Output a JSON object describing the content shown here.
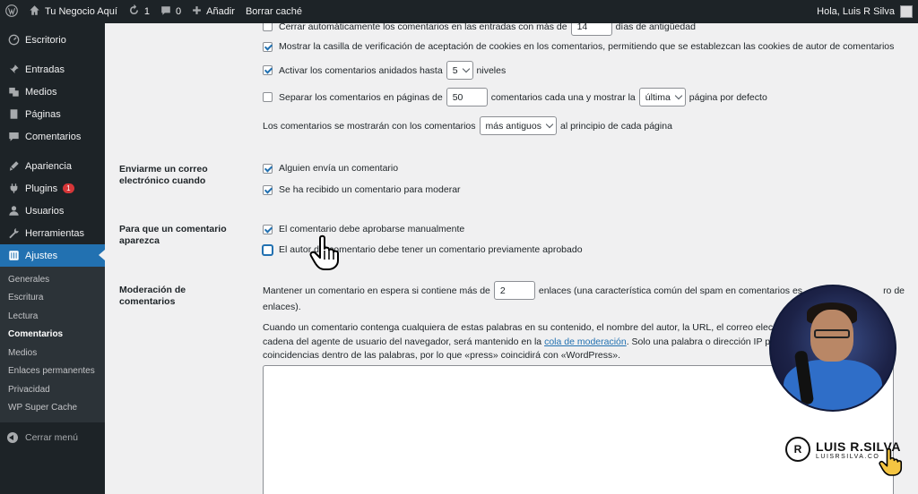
{
  "adminbar": {
    "site_name": "Tu Negocio Aquí",
    "updates_count": "1",
    "comments_count": "0",
    "add_new_label": "Añadir",
    "clear_cache_label": "Borrar caché",
    "greeting": "Hola, Luis R Silva"
  },
  "sidebar": {
    "items": [
      {
        "label": "Escritorio",
        "icon": "dashboard-icon"
      },
      {
        "label": "Entradas",
        "icon": "pin-icon"
      },
      {
        "label": "Medios",
        "icon": "media-icon"
      },
      {
        "label": "Páginas",
        "icon": "pages-icon"
      },
      {
        "label": "Comentarios",
        "icon": "comment-icon"
      },
      {
        "label": "Apariencia",
        "icon": "appearance-icon"
      },
      {
        "label": "Plugins",
        "icon": "plugins-icon",
        "badge": "1"
      },
      {
        "label": "Usuarios",
        "icon": "users-icon"
      },
      {
        "label": "Herramientas",
        "icon": "tools-icon"
      },
      {
        "label": "Ajustes",
        "icon": "settings-icon",
        "active": true
      }
    ],
    "submenu": [
      "Generales",
      "Escritura",
      "Lectura",
      "Comentarios",
      "Medios",
      "Enlaces permanentes",
      "Privacidad",
      "WP Super Cache"
    ],
    "submenu_current": "Comentarios",
    "collapse_label": "Cerrar menú"
  },
  "settings": {
    "close_comments": {
      "pre": "Cerrar automáticamente los comentarios en las entradas con más de",
      "value": "14",
      "post": "días de antigüedad",
      "checked": false
    },
    "cookies_opt_in": {
      "label": "Mostrar la casilla de verificación de aceptación de cookies en los comentarios, permitiendo que se establezcan las cookies de autor de comentarios",
      "checked": true
    },
    "threaded": {
      "pre": "Activar los comentarios anidados hasta",
      "value": "5",
      "post": "niveles",
      "checked": true
    },
    "paginate": {
      "pre": "Separar los comentarios en páginas de",
      "value": "50",
      "mid": "comentarios cada una y mostrar la",
      "select": "última",
      "post": "página por defecto",
      "checked": false
    },
    "order": {
      "pre": "Los comentarios se mostrarán con los comentarios",
      "select": "más antiguos",
      "post": "al principio de cada página"
    },
    "email_heading": "Enviarme un correo electrónico cuando",
    "email_anyone": {
      "label": "Alguien envía un comentario",
      "checked": true
    },
    "email_moderation": {
      "label": "Se ha recibido un comentario para moderar",
      "checked": true
    },
    "appear_heading": "Para que un comentario aparezca",
    "manual_approve": {
      "label": "El comentario debe aprobarse manualmente",
      "checked": true
    },
    "prev_approved": {
      "label": "El autor del comentario debe tener un comentario previamente aprobado",
      "checked": false
    },
    "moderation_heading": "Moderación de comentarios",
    "links_hold": {
      "pre": "Mantener un comentario en espera si contiene más de",
      "value": "2",
      "post": "enlaces (una característica común del spam en comentarios es",
      "post_tail": "ro de",
      "line2": "enlaces)."
    },
    "keywords_p1": "Cuando un comentario contenga cualquiera de estas palabras en su contenido, el nombre del autor, la URL, el correo elec",
    "keywords_p2_pre": "cadena del agente de usuario del navegador, será mantenido en la",
    "keywords_link": "cola de moderación",
    "keywords_p2_post": ". Solo una palabra o dirección IP pe",
    "keywords_p3": "coincidencias dentro de las palabras, por lo que «press» coincidirá con «WordPress»."
  },
  "watermark": {
    "name": "LUIS R.SILVA",
    "url": "LUISRSILVA.CO",
    "mark": "R"
  }
}
